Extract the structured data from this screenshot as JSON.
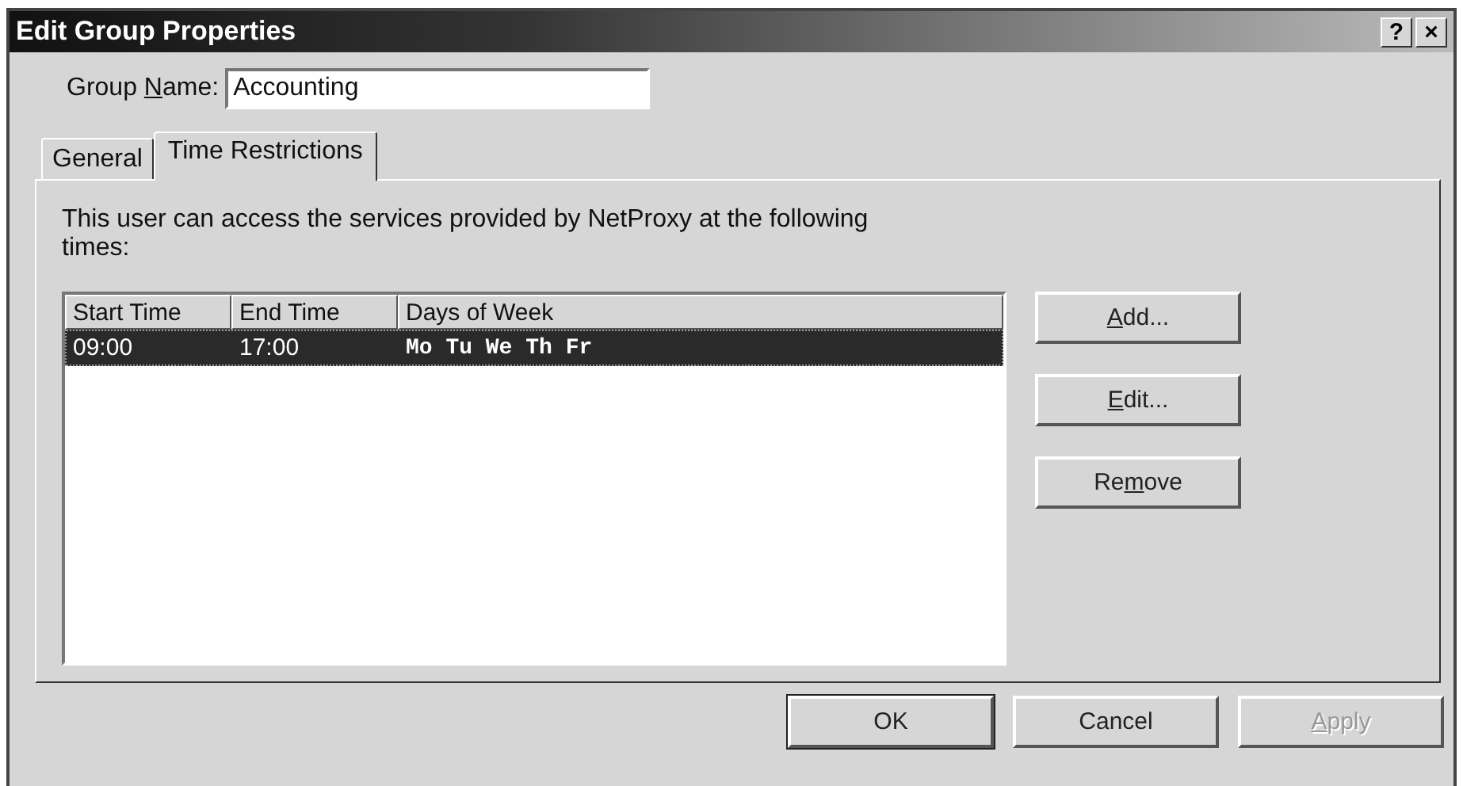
{
  "window": {
    "title": "Edit Group Properties",
    "title_buttons": [
      "?",
      "×"
    ]
  },
  "group_name": {
    "label": [
      {
        "text": "Group ",
        "underlined": false
      },
      {
        "text": "N",
        "underlined": true
      },
      {
        "text": "ame:",
        "underlined": false
      }
    ],
    "value": "Accounting"
  },
  "tabs": [
    {
      "label": "General",
      "selected": false
    },
    {
      "label": "Time Restrictions",
      "selected": true
    }
  ],
  "description": "This user can access the services provided by NetProxy at the following times:",
  "table": {
    "columns": [
      "Start Time",
      "End Time",
      "Days of Week"
    ],
    "rows": [
      {
        "cells": [
          "09:00",
          "17:00",
          "Mo Tu We Th Fr"
        ],
        "selected": true
      }
    ]
  },
  "side_buttons": [
    {
      "label": [
        {
          "text": "A",
          "underlined": true
        },
        {
          "text": "dd...",
          "underlined": false
        }
      ],
      "disabled": false
    },
    {
      "label": [
        {
          "text": "E",
          "underlined": true
        },
        {
          "text": "dit...",
          "underlined": false
        }
      ],
      "disabled": false
    },
    {
      "label": [
        {
          "text": "Re",
          "underlined": false
        },
        {
          "text": "m",
          "underlined": true
        },
        {
          "text": "ove",
          "underlined": false
        }
      ],
      "disabled": false
    }
  ],
  "buttons": [
    {
      "label": [
        {
          "text": "OK",
          "underlined": false
        }
      ],
      "disabled": false,
      "default": true
    },
    {
      "label": [
        {
          "text": "Cancel",
          "underlined": false
        }
      ],
      "disabled": false,
      "default": false
    },
    {
      "label": [
        {
          "text": "A",
          "underlined": true
        },
        {
          "text": "pply",
          "underlined": false
        }
      ],
      "disabled": true,
      "default": false
    }
  ]
}
